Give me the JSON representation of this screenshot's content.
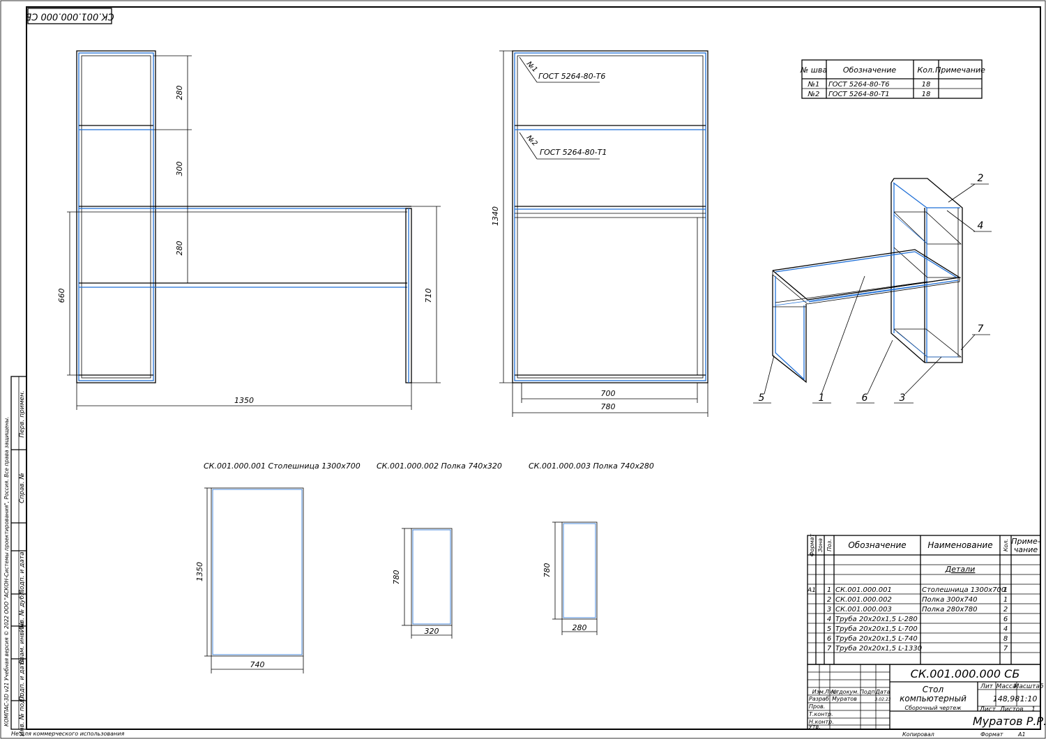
{
  "stamp_code": "СК.001.000.000 СБ",
  "main_view": {
    "dims": {
      "upper_gap": "280",
      "middle_gap": "300",
      "lower_gap": "280",
      "shelf_height": "660",
      "desk_height": "710",
      "overall_length": "1350"
    }
  },
  "side_view": {
    "dims": {
      "height": "1340",
      "inner_width": "700",
      "outer_width": "780"
    },
    "weld_1_tag": "№1",
    "weld_1_label": "ГОСТ 5264-80-Т6",
    "weld_2_tag": "№2",
    "weld_2_label": "ГОСТ 5264-80-Т1"
  },
  "weld_table": {
    "headers": [
      "№ шва",
      "Обозначение",
      "Кол.",
      "Примечание"
    ],
    "rows": [
      [
        "№1",
        "ГОСТ 5264-80-Т6",
        "18",
        ""
      ],
      [
        "№2",
        "ГОСТ 5264-80-Т1",
        "18",
        ""
      ]
    ]
  },
  "iso_callouts": [
    "1",
    "2",
    "3",
    "4",
    "5",
    "6",
    "7"
  ],
  "parts": [
    {
      "title": "СК.001.000.001 Столешница 1300х700",
      "height_dim": "1350",
      "width_dim": "740"
    },
    {
      "title": "СК.001.000.002 Полка 740х320",
      "height_dim": "780",
      "width_dim": "320"
    },
    {
      "title": "СК.001.000.003 Полка 740х280",
      "height_dim": "780",
      "width_dim": "280"
    }
  ],
  "spec": {
    "headers": {
      "format": "Формат",
      "zone": "Зона",
      "pos": "Поз.",
      "designation": "Обозначение",
      "name": "Наименование",
      "qty": "Кол.",
      "note_1": "Приме-",
      "note_2": "чание"
    },
    "section": "Детали",
    "format_value": "А1",
    "rows": [
      {
        "pos": "1",
        "designation": "СК.001.000.001",
        "name": "Столешница 1300х700",
        "qty": "1"
      },
      {
        "pos": "2",
        "designation": "СК.001.000.002",
        "name": "Полка 300х740",
        "qty": "1"
      },
      {
        "pos": "3",
        "designation": "СК.001.000.003",
        "name": "Полка 280х780",
        "qty": "2"
      },
      {
        "pos": "4",
        "designation": "Труба 20х20х1,5 L-280",
        "name": "",
        "qty": "6"
      },
      {
        "pos": "5",
        "designation": "Труба 20х20х1,5 L-700",
        "name": "",
        "qty": "4"
      },
      {
        "pos": "6",
        "designation": "Труба 20х20х1,5 L-740",
        "name": "",
        "qty": "8"
      },
      {
        "pos": "7",
        "designation": "Труба 20х20х1,5 L-1330",
        "name": "",
        "qty": "7"
      }
    ]
  },
  "title_block": {
    "code": "СК.001.000.000 СБ",
    "name_1": "Стол",
    "name_2": "компьютерный",
    "doc_type": "Сборочный чертеж",
    "lit_label": "Лит",
    "mass_label": "Масса",
    "scale_label": "Масштаб",
    "mass": "148,98",
    "scale": "1:10",
    "sheet_label": "Лист",
    "sheets_label": "Листов",
    "sheets": "1",
    "author": "Муратов Р.Р.",
    "rows": {
      "izm": "Изм.",
      "list": "Лист",
      "doc_no": "№ докум.",
      "sign": "Подп.",
      "date": "Дата",
      "razrab": "Разраб.",
      "razrab_name": "Муратов",
      "date_value": "3.02.23",
      "prov": "Пров.",
      "tkontr": "Т.контр.",
      "nkontr": "Н.контр.",
      "utv": "Утв."
    },
    "copied": "Копировал",
    "format_label": "Формат",
    "format_value": "А1"
  },
  "left_strip": {
    "perv_primen": "Перв. примен.",
    "sprav_no": "Справ. №",
    "podp_data_1": "Подп. и дата",
    "inv_dubl": "Инв. № дубл.",
    "vzam_inv": "Взам. инв. №",
    "podp_data_2": "Подп. и дата",
    "inv_podl": "Инв. № подл."
  },
  "copyright": "КОМПАС-3D v21 Учебная версия © 2022 ООО \"АСКОН-Системы проектирования\", Россия. Все права защищены.",
  "non_commercial": "Не для коммерческого использования"
}
